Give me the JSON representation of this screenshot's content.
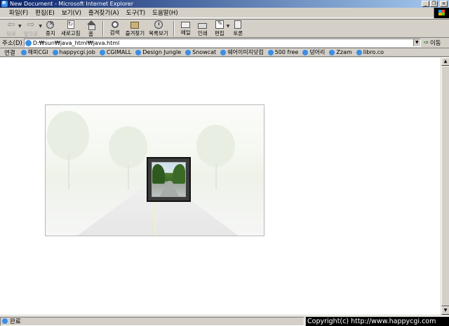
{
  "window": {
    "title": "New Document - Microsoft Internet Explorer"
  },
  "menu": [
    "파일(F)",
    "편집(E)",
    "보기(V)",
    "즐겨찾기(A)",
    "도구(T)",
    "도움말(H)"
  ],
  "toolbar": {
    "back": "뒤로",
    "forward": "앞으로",
    "stop": "중지",
    "refresh": "새로고침",
    "home": "홈",
    "search": "검색",
    "favorites": "즐겨찾기",
    "history": "목록보기",
    "mail": "메일",
    "print": "인쇄",
    "edit": "편집",
    "discuss": "토론"
  },
  "address": {
    "label": "주소(D)",
    "url": "D:₩sun₩java_html₩java.html",
    "go": "이동"
  },
  "links": {
    "label": "연결",
    "items": [
      "해피CGI",
      "happycgi.job",
      "CGIMALL",
      "Design Jungle",
      "Snowcat",
      "쉐어이미지닷컴",
      "500 free",
      "덩어리",
      "Zzam",
      "libro.co"
    ]
  },
  "status": {
    "text": "완료",
    "copyright": "Copyright(c) http://www.happycgi.com"
  }
}
